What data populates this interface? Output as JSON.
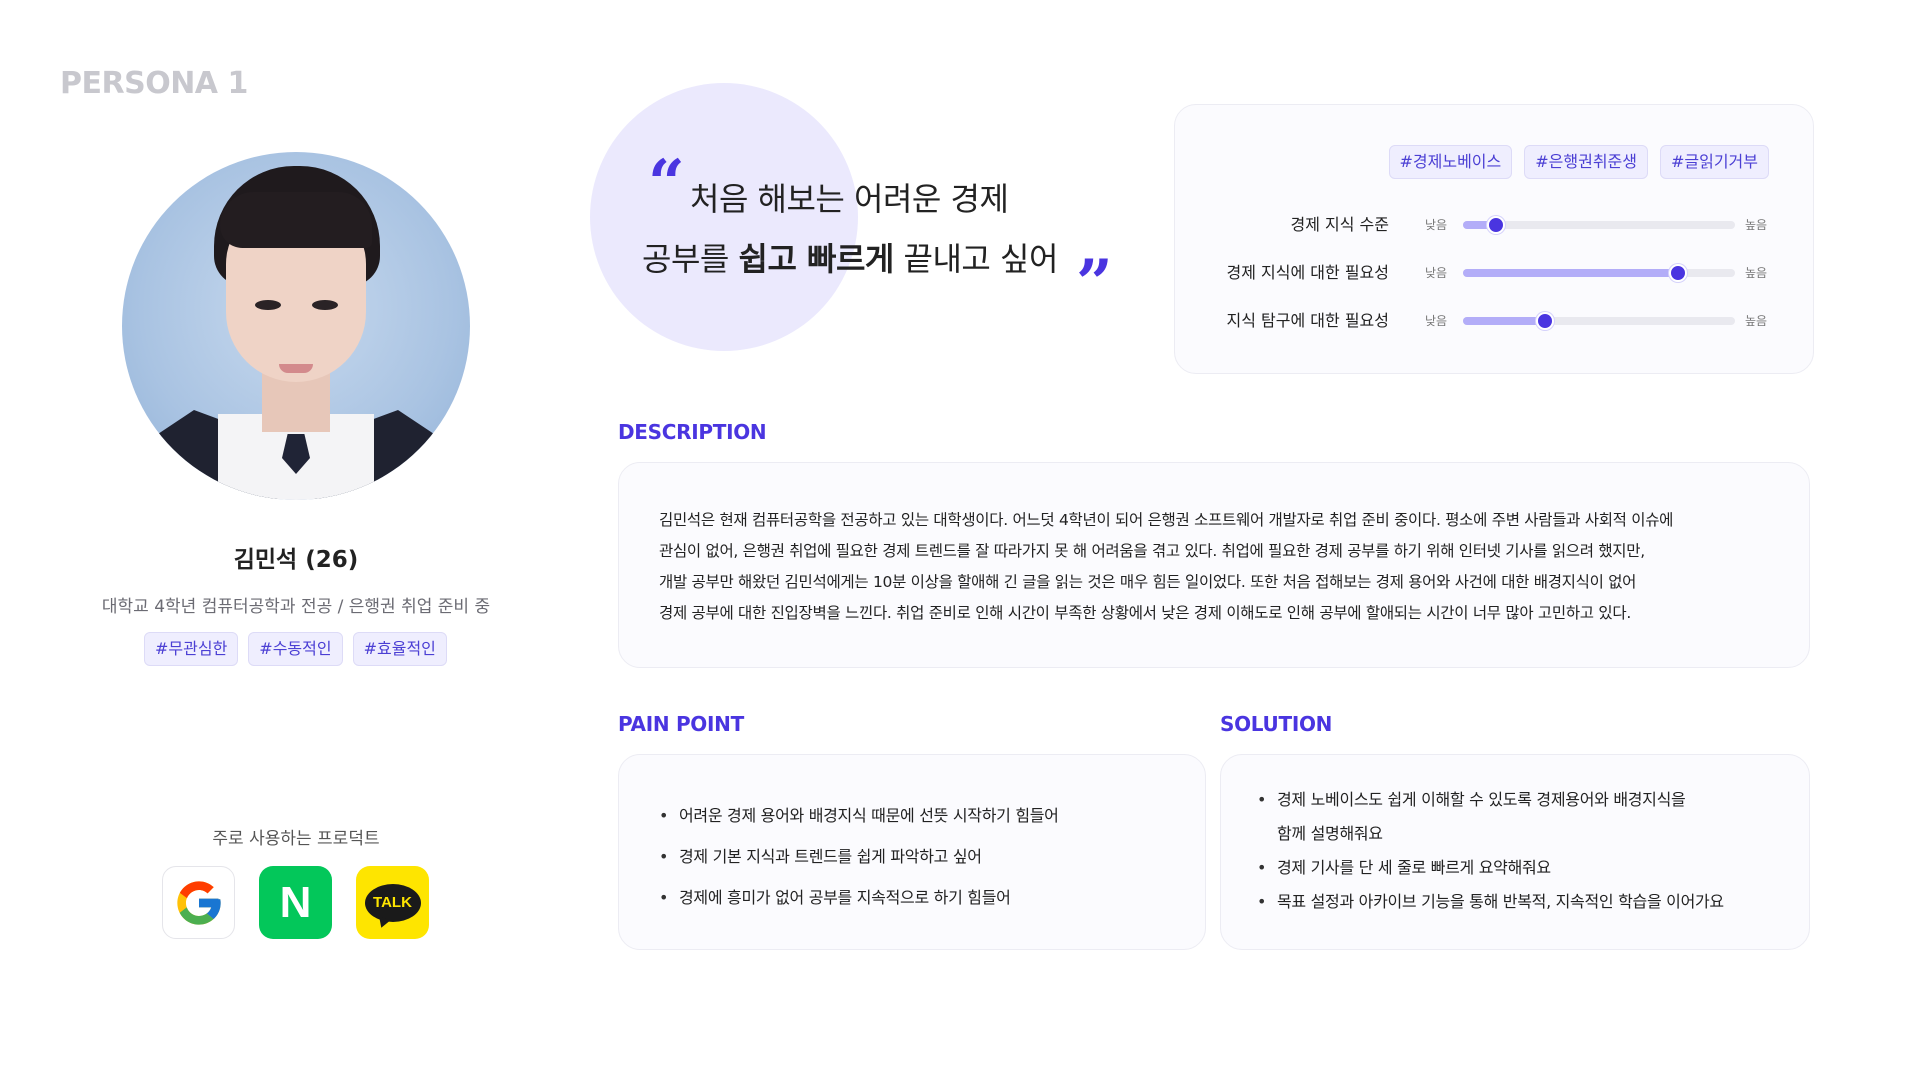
{
  "persona": {
    "label": "PERSONA 1"
  },
  "profile": {
    "name": "김민석 (26)",
    "subtitle": "대학교 4학년 컴퓨터공학과 전공 / 은행권 취업 준비 중",
    "tags": [
      "#무관심한",
      "#수동적인",
      "#효율적인"
    ]
  },
  "products": {
    "label": "주로 사용하는 프로덕트",
    "items": [
      {
        "name": "google-icon",
        "glyph": "G"
      },
      {
        "name": "naver-icon",
        "glyph": "N"
      },
      {
        "name": "kakaotalk-icon",
        "glyph": "TALK"
      }
    ]
  },
  "quote": {
    "open_mark": "“",
    "close_mark": "”",
    "line1": "처음 해보는 어려운 경제",
    "line2_prefix": "공부를 ",
    "line2_bold": "쉽고 빠르게",
    "line2_suffix": " 끝내고 싶어"
  },
  "scales": {
    "tags": [
      "#경제노베이스",
      "#은행권취준생",
      "#글읽기거부"
    ],
    "low_label": "낮음",
    "high_label": "높음",
    "items": [
      {
        "label": "경제 지식 수준",
        "value": 0.12
      },
      {
        "label": "경제 지식에 대한 필요성",
        "value": 0.79
      },
      {
        "label": "지식 탐구에 대한 필요성",
        "value": 0.3
      }
    ]
  },
  "description": {
    "title": "DESCRIPTION",
    "lines": [
      "김민석은 현재 컴퓨터공학을 전공하고 있는 대학생이다. 어느덧 4학년이 되어 은행권 소프트웨어 개발자로 취업 준비 중이다. 평소에 주변 사람들과 사회적 이슈에",
      "관심이 없어, 은행권 취업에 필요한 경제 트렌드를 잘 따라가지 못 해 어려움을 겪고 있다. 취업에 필요한 경제 공부를 하기 위해 인터넷 기사를 읽으려 했지만,",
      "개발 공부만 해왔던 김민석에게는 10분 이상을 할애해 긴 글을 읽는 것은 매우 힘든 일이었다. 또한 처음 접해보는 경제 용어와 사건에 대한 배경지식이 없어",
      "경제 공부에 대한 진입장벽을 느낀다. 취업 준비로 인해 시간이 부족한 상황에서 낮은 경제 이해도로 인해 공부에 할애되는 시간이 너무 많아 고민하고 있다."
    ]
  },
  "pain_point": {
    "title": "PAIN POINT",
    "items": [
      "어려운 경제 용어와 배경지식 때문에 선뜻 시작하기 힘들어",
      "경제 기본 지식과 트렌드를 쉽게 파악하고 싶어",
      "경제에 흥미가 없어 공부를 지속적으로 하기 힘들어"
    ]
  },
  "solution": {
    "title": "SOLUTION",
    "items": [
      "경제 노베이스도 쉽게 이해할 수 있도록 경제용어와 배경지식을",
      "함께 설명해줘요",
      "경제 기사를 단 세 줄로 빠르게 요약해줘요",
      "목표 설정과 아카이브 기능을 통해 반복적, 지속적인 학습을 이어가요"
    ]
  },
  "colors": {
    "accent": "#4a35e0",
    "accent_light": "#ebe9fd",
    "slider_fill": "#b3adf8"
  }
}
